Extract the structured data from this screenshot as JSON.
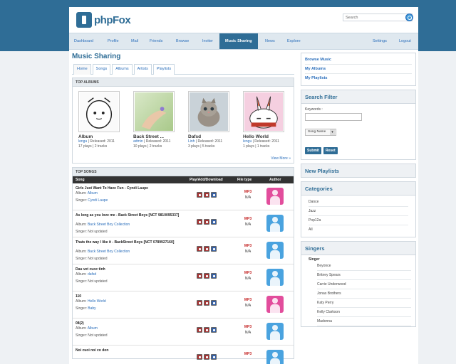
{
  "header": {
    "logo_text": "phpFox",
    "search_placeholder": "Search"
  },
  "nav": {
    "items": [
      "Dashboard",
      "Profile",
      "Mail",
      "Friends",
      "Browse",
      "Inviter",
      "Music Sharing",
      "News",
      "Explore"
    ],
    "right": [
      "Settings",
      "Logout"
    ],
    "active": "Music Sharing"
  },
  "main": {
    "title": "Music Sharing",
    "tabs": [
      "Home",
      "Songs",
      "Albums",
      "Artists",
      "Playlists"
    ]
  },
  "top_albums": {
    "title": "TOP ALBUMS",
    "view_more": "View More »",
    "items": [
      {
        "name": "Album",
        "author": "lengu",
        "released": " | Released: 2011",
        "plays": "17 plays | 2 tracks"
      },
      {
        "name": "Back Street ...",
        "author": "admin",
        "released": " | Released: 2011",
        "plays": "10 plays | 2 tracks"
      },
      {
        "name": "Dafsd",
        "author": "Linh",
        "released": " | Released: 2011",
        "plays": "3 plays | 5 tracks"
      },
      {
        "name": "Hello World",
        "author": "lengu",
        "released": " | Released: 2011",
        "plays": "1 plays | 1 tracks"
      }
    ]
  },
  "top_songs": {
    "title": "TOP SONGS",
    "columns": [
      "Song",
      "Play/Add/Download",
      "File type",
      "Author"
    ],
    "album_prefix": "Album: ",
    "singer_prefix": "Singer: ",
    "rows": [
      {
        "title": "Girls Just Want To Have Fun - Cyndi Laupe",
        "album": "Album",
        "singer": "Cyndi Laupe",
        "singer_linked": true,
        "type": "MP3",
        "size": "N/A",
        "author_color": "blue-pink"
      },
      {
        "title": "As long as you love me - Back Street Boys [NCT 9810095337]",
        "album": "Back Street Boy Collection",
        "singer": "Not updated",
        "singer_linked": false,
        "type": "MP3",
        "size": "N/A",
        "author_color": "blue"
      },
      {
        "title": "Thats the way I like it - BackStreet Boys [NCT 0789927160]",
        "album": "Back Street Boy Collection",
        "singer": "Not updated",
        "singer_linked": false,
        "type": "MP3",
        "size": "N/A",
        "author_color": "blue"
      },
      {
        "title": "Dau vet cuoc tinh",
        "album": "dafsd",
        "singer": "Not updated",
        "singer_linked": false,
        "type": "MP3",
        "size": "N/A",
        "author_color": "blue-pink"
      },
      {
        "title": "110",
        "album": "Hello World",
        "singer": "Baby",
        "singer_linked": true,
        "type": "MP3",
        "size": "N/A",
        "author_color": "blue-pink"
      },
      {
        "title": "08(2)",
        "album": "Album",
        "singer": "Not updated",
        "singer_linked": false,
        "type": "MP3",
        "size": "N/A",
        "author_color": "blue-pink"
      },
      {
        "title": "Noi cuoi noi co don",
        "album": "",
        "singer": "",
        "singer_linked": false,
        "type": "MP3",
        "size": "",
        "author_color": "blue"
      }
    ]
  },
  "sidebar": {
    "links": [
      "Browse Music",
      "My Albums",
      "My Playlists"
    ],
    "search_filter": {
      "title": "Search Filter",
      "keywords_label": "Keywords :",
      "sort_value": "Song Name",
      "submit": "Submit",
      "reset": "Reset"
    },
    "new_playlists": "New Playlists",
    "categories": {
      "title": "Categories",
      "items": [
        "Dance",
        "Jazz",
        "Pop12a",
        "All"
      ]
    },
    "singers": {
      "title": "Singers",
      "subheading": "Singer",
      "items": [
        "Beyonce",
        "Britney Spears",
        "Carrie Underwood",
        "Jonas Brothers",
        "Katy Perry",
        "Kelly Clarkson",
        "Madonna"
      ]
    }
  }
}
